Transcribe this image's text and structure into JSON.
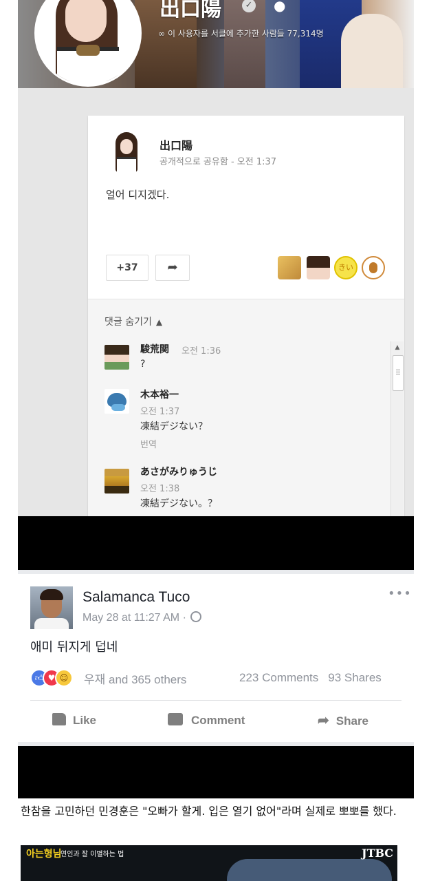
{
  "gplus": {
    "profile_name": "出口陽",
    "follower_line": "이 사용자를 서클에 추가한 사람들 77,314명",
    "post": {
      "author": "出口陽",
      "meta": "공개적으로 공유함  -  오전 1:37",
      "text": "얼어 디지겠다.",
      "plus_count": "+37",
      "reactor_3_label": "きいど"
    },
    "comments_toggle": "댓글 숨기기",
    "comments": [
      {
        "name": "駿荒関",
        "time": "오전 1:36",
        "text": "?",
        "translate": ""
      },
      {
        "name": "木本裕一",
        "time": "오전 1:37",
        "text": "凍結デジない？",
        "translate": "번역"
      },
      {
        "name": "あさがみりゅうじ",
        "time": "오전 1:38",
        "text": "凍結デジない。？",
        "translate": ""
      }
    ]
  },
  "facebook": {
    "name": "Salamanca Tuco",
    "time": "May 28 at 11:27 AM ·",
    "more": "•••",
    "text": "애미 뒤지게 덥네",
    "reactions_text": "우재 and 365 others",
    "comments_count": "223 Comments",
    "shares_count": "93 Shares",
    "actions": {
      "like": "Like",
      "comment": "Comment",
      "share": "Share"
    }
  },
  "article": {
    "text": "한참을 고민하던 민경훈은 \"오빠가 할게. 입은 열기 없어\"라며 실제로 뽀뽀를 했다.",
    "video_logo": "아는형님",
    "video_caption": "연인과 잘 이별하는 법",
    "video_channel": "JTBC"
  },
  "colors": {
    "fb_blue": "#4b79e6",
    "love_red": "#f0384b",
    "haha_yellow": "#f7c83c",
    "band": "#000000"
  }
}
